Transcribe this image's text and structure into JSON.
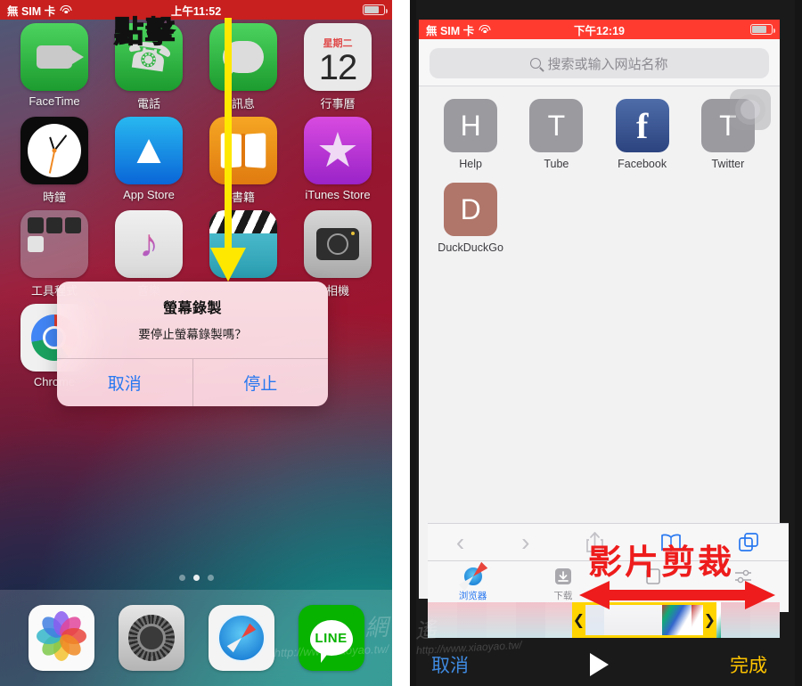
{
  "left_phone": {
    "status_bar": {
      "carrier": "無 SIM 卡",
      "time": "上午11:52",
      "wifi_icon": "wifi-icon",
      "battery_icon": "battery-icon",
      "recording_color": "#c8201f"
    },
    "annotation": {
      "label": "點擊",
      "color": "#ffe800",
      "arrow": "down-arrow-yellow"
    },
    "apps": [
      {
        "label": "FaceTime",
        "icon": "facetime-icon"
      },
      {
        "label": "電話",
        "icon": "phone-icon"
      },
      {
        "label": "訊息",
        "icon": "messages-icon"
      },
      {
        "label": "行事曆",
        "icon": "calendar-icon",
        "weekday": "星期二",
        "day": "12"
      },
      {
        "label": "時鐘",
        "icon": "clock-icon"
      },
      {
        "label": "App Store",
        "icon": "appstore-icon"
      },
      {
        "label": "書籍",
        "icon": "books-icon"
      },
      {
        "label": "iTunes Store",
        "icon": "itunes-store-icon"
      },
      {
        "label": "工具程式",
        "icon": "utilities-folder-icon"
      },
      {
        "label": "音樂",
        "icon": "music-icon"
      },
      {
        "label": "",
        "icon": "imovie-icon"
      },
      {
        "label": "相機",
        "icon": "camera-icon"
      },
      {
        "label": "Chrome",
        "icon": "chrome-icon"
      }
    ],
    "page_dots": {
      "count": 3,
      "active_index": 1
    },
    "dock": [
      {
        "label": "Photos",
        "icon": "photos-icon"
      },
      {
        "label": "Settings",
        "icon": "settings-gear-icon"
      },
      {
        "label": "Safari",
        "icon": "safari-compass-icon"
      },
      {
        "label": "LINE",
        "icon": "line-icon",
        "text": "LINE"
      }
    ],
    "alert": {
      "title": "螢幕錄製",
      "message": "要停止螢幕錄製嗎？",
      "cancel_label": "取消",
      "stop_label": "停止",
      "button_color": "#2878f0"
    },
    "watermark": {
      "big": "網",
      "small": "http://www.xiaoyao.tw/"
    }
  },
  "right_phone": {
    "status_bar": {
      "carrier": "無 SIM 卡",
      "time": "下午12:19",
      "wifi_icon": "wifi-icon",
      "battery_icon": "battery-icon",
      "recording_color": "#ff3b30"
    },
    "search": {
      "placeholder": "搜索或输入网站名称",
      "icon": "search-icon"
    },
    "favorites": [
      {
        "label": "Help",
        "letter": "H",
        "color": "#9a9a9f"
      },
      {
        "label": "Tube",
        "letter": "T",
        "color": "#9a9a9f"
      },
      {
        "label": "Facebook",
        "letter": "f",
        "color": "#3b5998"
      },
      {
        "label": "Twitter",
        "letter": "T",
        "color": "#9a9a9f"
      },
      {
        "label": "DuckDuckGo",
        "letter": "D",
        "color": "#b0766a"
      }
    ],
    "assistive_touch": "assistive-touch-icon",
    "toolbar": [
      {
        "name": "back-icon",
        "glyph": "‹",
        "active": false
      },
      {
        "name": "forward-icon",
        "glyph": "›",
        "active": false
      },
      {
        "name": "share-icon",
        "glyph": "share",
        "active": false
      },
      {
        "name": "bookmarks-icon",
        "glyph": "book",
        "active": true
      },
      {
        "name": "tabs-icon",
        "glyph": "tabs",
        "active": true
      }
    ],
    "tabs": [
      {
        "label": "浏览器",
        "icon": "compass-icon",
        "active": true
      },
      {
        "label": "下载",
        "icon": "download-icon",
        "active": false
      },
      {
        "label": "书签",
        "icon": "bookmark-icon",
        "active": false
      },
      {
        "label": "Settings",
        "icon": "settings-icon",
        "active": false
      }
    ],
    "annotation": {
      "label": "影片剪裁",
      "color": "#ee1c1c",
      "arrow": "double-headed-red-arrow"
    },
    "trimmer": {
      "handle_left": "❮",
      "handle_right": "❯",
      "selection_color": "#ffd400"
    },
    "controls": {
      "cancel_label": "取消",
      "cancel_color": "#3f8ae0",
      "play_icon": "play-icon",
      "done_label": "完成",
      "done_color": "#ffc400"
    },
    "watermark": {
      "big": "遙",
      "small": "http://www.xiaoyao.tw/"
    }
  }
}
